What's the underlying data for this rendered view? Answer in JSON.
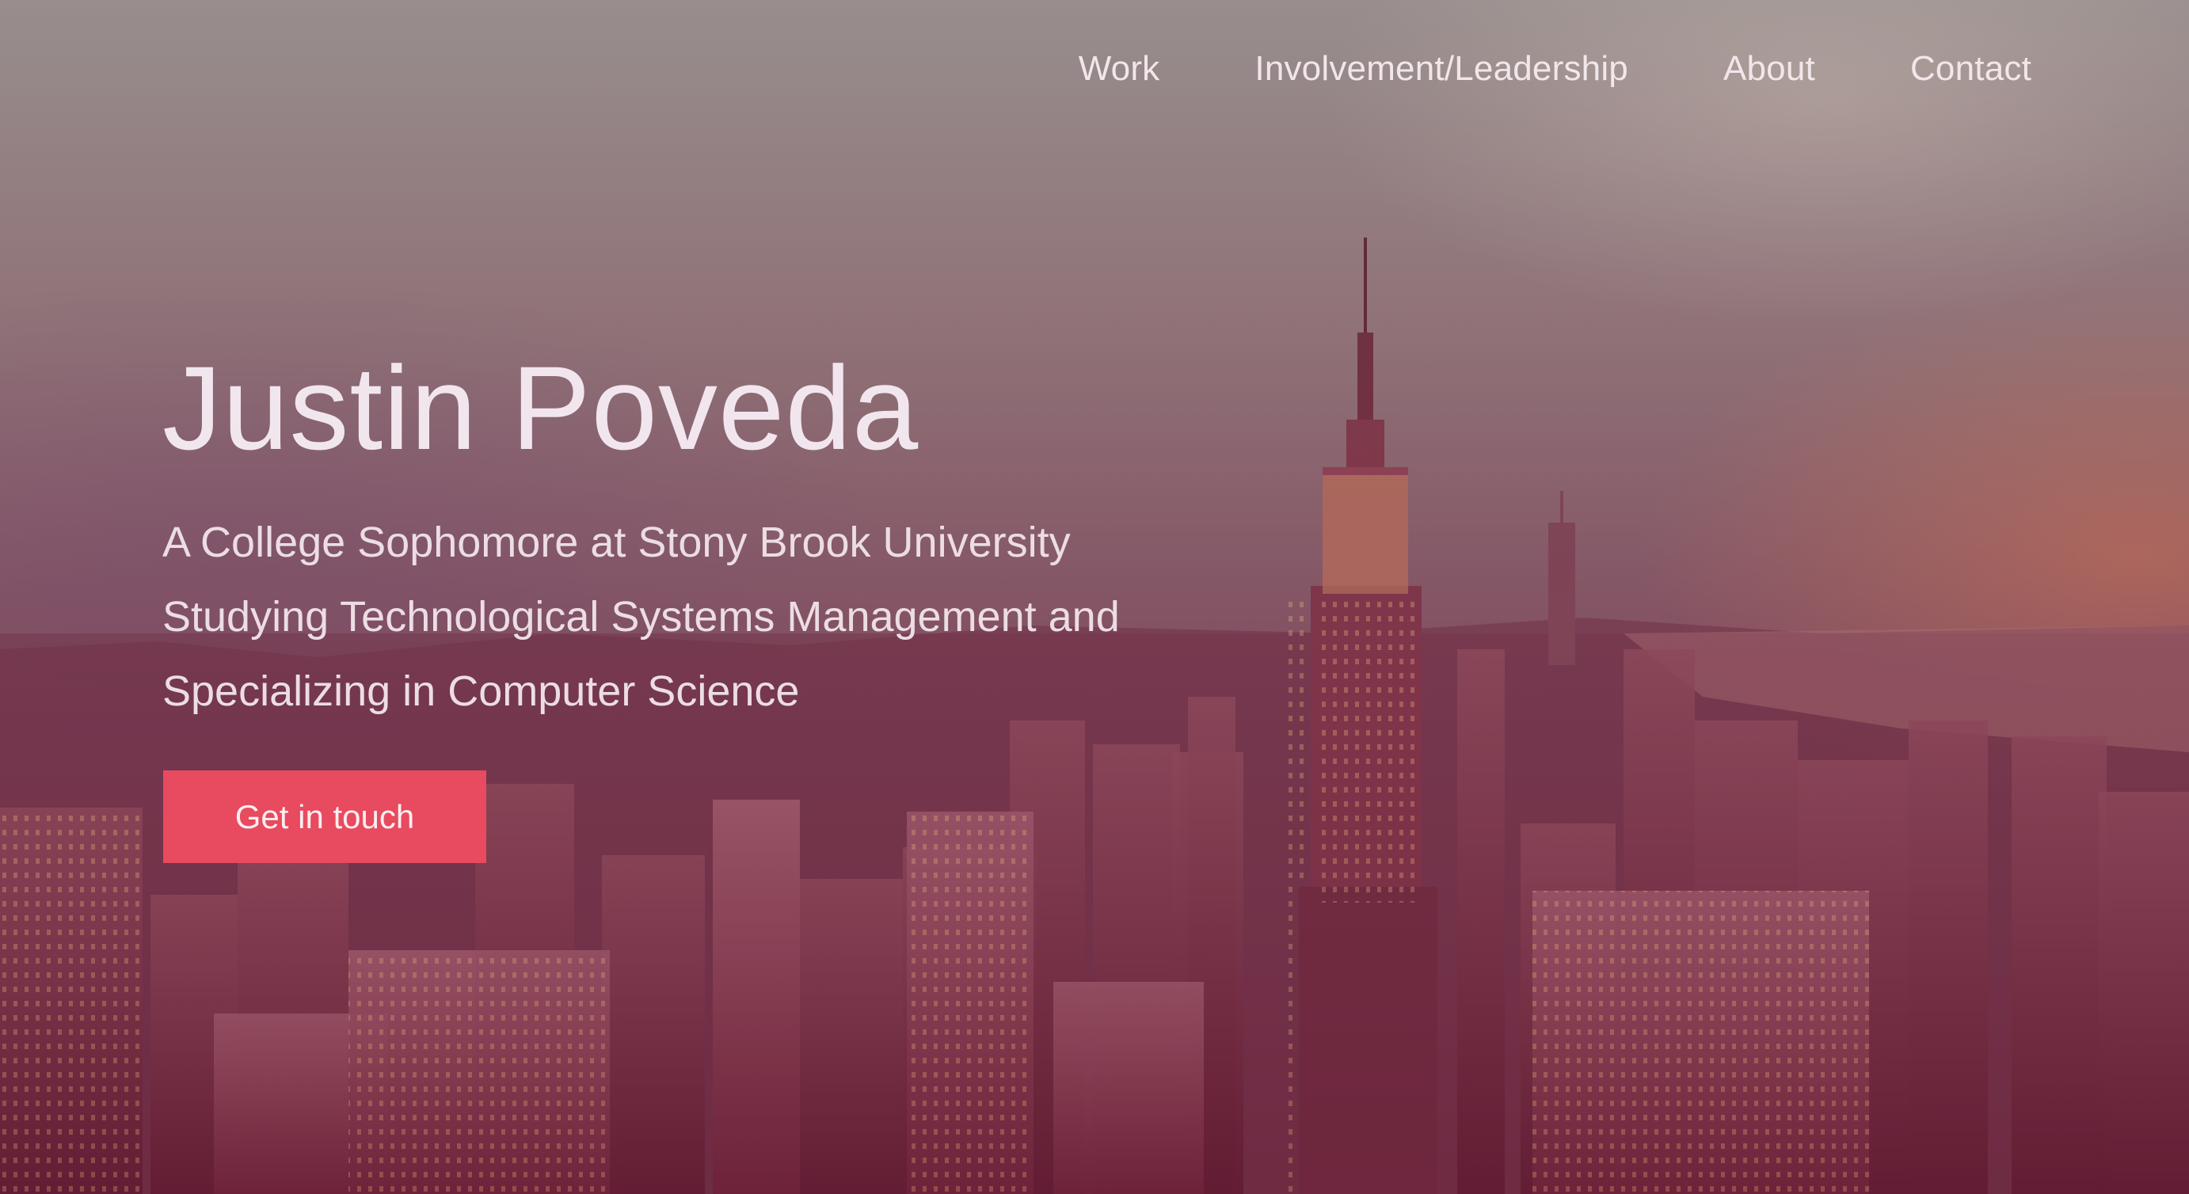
{
  "nav": {
    "items": [
      {
        "label": "Work"
      },
      {
        "label": "Involvement/Leadership"
      },
      {
        "label": "About"
      },
      {
        "label": "Contact"
      }
    ]
  },
  "hero": {
    "name": "Justin Poveda",
    "tagline_lines": [
      "A College Sophomore at Stony Brook University",
      "Studying Technological Systems Management and",
      "Specializing in Computer Science"
    ],
    "cta_label": "Get in touch"
  },
  "colors": {
    "accent": "#e84a5f",
    "text": "#f2e6ee"
  }
}
